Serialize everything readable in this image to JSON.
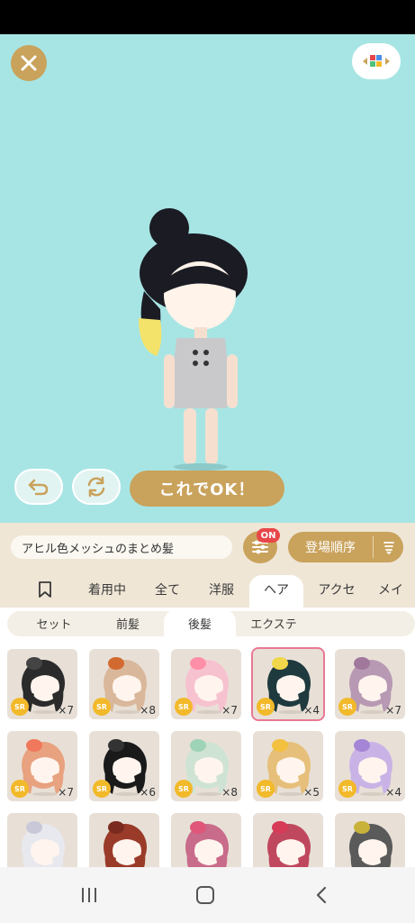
{
  "stage": {
    "ok_label": "これでOK！"
  },
  "info": {
    "item_name": "アヒル色メッシュのまとめ髪",
    "filter_badge": "ON",
    "sort_label": "登場順序"
  },
  "tabs": [
    "着用中",
    "全て",
    "洋服",
    "ヘア",
    "アクセ",
    "メイ"
  ],
  "subtabs": [
    "セット",
    "前髪",
    "後髪",
    "エクステ"
  ],
  "items": [
    {
      "rarity": "SR",
      "count": "×7",
      "hair": "#2b2b2b",
      "accent": "#444"
    },
    {
      "rarity": "SR",
      "count": "×8",
      "hair": "#d9b79a",
      "accent": "#d2692f"
    },
    {
      "rarity": "SR",
      "count": "×7",
      "hair": "#f7c2cf",
      "accent": "#ff8fa8"
    },
    {
      "rarity": "SR",
      "count": "×4",
      "hair": "#1f3a3e",
      "accent": "#f0d64a"
    },
    {
      "rarity": "SR",
      "count": "×7",
      "hair": "#b899b3",
      "accent": "#a0789b"
    },
    {
      "rarity": "SR",
      "count": "×7",
      "hair": "#e8a27f",
      "accent": "#f0785c"
    },
    {
      "rarity": "SR",
      "count": "×6",
      "hair": "#1a1a1a",
      "accent": "#333"
    },
    {
      "rarity": "SR",
      "count": "×8",
      "hair": "#cfe3d4",
      "accent": "#9fd3b7"
    },
    {
      "rarity": "SR",
      "count": "×5",
      "hair": "#e6c07a",
      "accent": "#f3c03f"
    },
    {
      "rarity": "SR",
      "count": "×4",
      "hair": "#c9b3e6",
      "accent": "#a585d6"
    },
    {
      "rarity": "",
      "count": "",
      "hair": "#e8e8ef",
      "accent": "#c8c8d8"
    },
    {
      "rarity": "",
      "count": "",
      "hair": "#9a3b2a",
      "accent": "#7a2a1e"
    },
    {
      "rarity": "",
      "count": "",
      "hair": "#c96b8a",
      "accent": "#e0557a"
    },
    {
      "rarity": "",
      "count": "",
      "hair": "#c0485e",
      "accent": "#d63b58"
    },
    {
      "rarity": "",
      "count": "",
      "hair": "#5a5a5a",
      "accent": "#c9b23a"
    }
  ]
}
